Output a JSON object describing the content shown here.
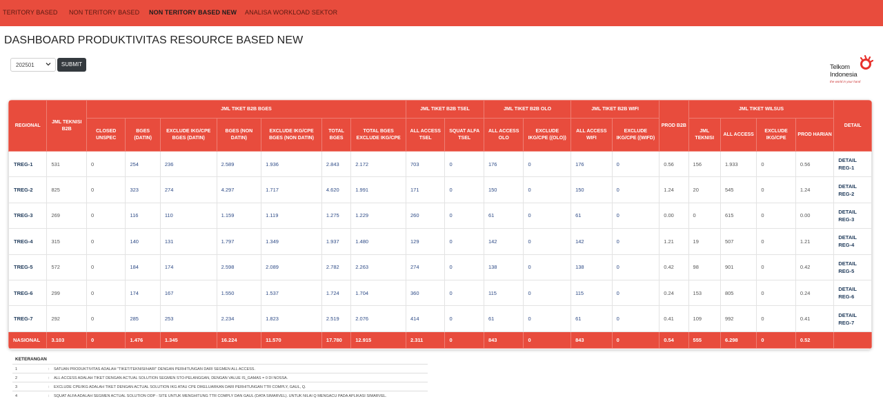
{
  "nav": {
    "items": [
      {
        "label": "TERITORY BASED",
        "active": false
      },
      {
        "label": "NON TERITORY BASED",
        "active": false
      },
      {
        "label": "NON TERITORY BASED NEW",
        "active": true
      },
      {
        "label": "ANALISA WORKLOAD SEKTOR",
        "active": false
      }
    ]
  },
  "page_title": "DASHBOARD PRODUKTIVITAS RESOURCE BASED NEW",
  "filter": {
    "period_value": "202501",
    "submit_label": "SUBMIT"
  },
  "logo": {
    "line1": "Telkom",
    "line2": "Indonesia",
    "tagline": "the world in your hand"
  },
  "table": {
    "group_headers": {
      "regional": "REGIONAL",
      "jml_teknisi_b2b": "JML TEKNISI B2B",
      "bges": "JML TIKET B2B BGES",
      "tsel": "JML TIKET B2B TSEL",
      "olo": "JML TIKET B2B OLO",
      "wifi": "JML TIKET B2B WIFI",
      "prod_b2b": "PROD B2B",
      "wilsus": "JML TIKET WILSUS",
      "detail": "DETAIL"
    },
    "sub_headers": [
      "CLOSED UNSPEC",
      "BGES (DATIN)",
      "EXCLUDE IKG/CPE BGES (DATIN)",
      "BGES (NON DATIN)",
      "EXCLUDE IKG/CPE BGES (NON DATIN)",
      "TOTAL BGES",
      "TOTAL BGES EXCLUDE IKG/CPE",
      "ALL ACCESS TSEL",
      "SQUAT ALFA TSEL",
      "ALL ACCESS OLO",
      "EXCLUDE IKG/CPE ((OLO))",
      "ALL ACCESS WIFI",
      "EXCLUDE IKG/CPE ((WIFD)",
      "JML TEKNISI",
      "ALL ACCESS",
      "EXCLUDE IKG/CPE",
      "PROD HARIAN"
    ],
    "rows": [
      {
        "region": "TREG-1",
        "cells": [
          "531",
          "0",
          "254",
          "236",
          "2.589",
          "1.936",
          "2.843",
          "2.172",
          "703",
          "0",
          "176",
          "0",
          "176",
          "0",
          "0.56",
          "156",
          "1.933",
          "0",
          "0.56"
        ],
        "detail": [
          "DETAIL",
          "REG-1"
        ]
      },
      {
        "region": "TREG-2",
        "cells": [
          "825",
          "0",
          "323",
          "274",
          "4.297",
          "1.717",
          "4.620",
          "1.991",
          "171",
          "0",
          "150",
          "0",
          "150",
          "0",
          "1.24",
          "20",
          "545",
          "0",
          "1.24"
        ],
        "detail": [
          "DETAIL",
          "REG-2"
        ]
      },
      {
        "region": "TREG-3",
        "cells": [
          "269",
          "0",
          "116",
          "110",
          "1.159",
          "1.119",
          "1.275",
          "1.229",
          "260",
          "0",
          "61",
          "0",
          "61",
          "0",
          "0.00",
          "0",
          "615",
          "0",
          "0.00"
        ],
        "detail": [
          "DETAIL",
          "REG-3"
        ]
      },
      {
        "region": "TREG-4",
        "cells": [
          "315",
          "0",
          "140",
          "131",
          "1.797",
          "1.349",
          "1.937",
          "1.480",
          "129",
          "0",
          "142",
          "0",
          "142",
          "0",
          "1.21",
          "19",
          "507",
          "0",
          "1.21"
        ],
        "detail": [
          "DETAIL",
          "REG-4"
        ]
      },
      {
        "region": "TREG-5",
        "cells": [
          "572",
          "0",
          "184",
          "174",
          "2.598",
          "2.089",
          "2.782",
          "2.263",
          "274",
          "0",
          "138",
          "0",
          "138",
          "0",
          "0.42",
          "98",
          "901",
          "0",
          "0.42"
        ],
        "detail": [
          "DETAIL",
          "REG-5"
        ]
      },
      {
        "region": "TREG-6",
        "cells": [
          "299",
          "0",
          "174",
          "167",
          "1.550",
          "1.537",
          "1.724",
          "1.704",
          "360",
          "0",
          "115",
          "0",
          "115",
          "0",
          "0.24",
          "153",
          "805",
          "0",
          "0.24"
        ],
        "detail": [
          "DETAIL",
          "REG-6"
        ]
      },
      {
        "region": "TREG-7",
        "cells": [
          "292",
          "0",
          "285",
          "253",
          "2.234",
          "1.823",
          "2.519",
          "2.076",
          "414",
          "0",
          "61",
          "0",
          "61",
          "0",
          "0.41",
          "109",
          "992",
          "0",
          "0.41"
        ],
        "detail": [
          "DETAIL",
          "REG-7"
        ]
      }
    ],
    "total": {
      "region": "NASIONAL",
      "cells": [
        "3.103",
        "0",
        "1.476",
        "1.345",
        "16.224",
        "11.570",
        "17.780",
        "12.915",
        "2.311",
        "0",
        "843",
        "0",
        "843",
        "0",
        "0.54",
        "555",
        "6.298",
        "0",
        "0.52"
      ],
      "detail": ""
    }
  },
  "notes": {
    "title": "KETERANGAN",
    "items": [
      {
        "no": "1",
        "text": "SATUAN PRODUKTIVITAS ADALAH \"TIKET/TEKNISI/HARI\" DENGAN PERHITUNGAN DARI SEGMEN ALL ACCESS."
      },
      {
        "no": "2",
        "text": "ALL ACCESS ADALAH TIKET DENGAN ACTUAL SOLUTION SEGMEN STO-PELANGGAN, DENGAN VALUE IS_GAMAS = 0 DI NOSSA."
      },
      {
        "no": "3",
        "text": "EXCLUDE CPE/IKG ADALAH TIKET DENGAN ACTUAL SOLUTION IKG ATAU CPE DIKELUARKAN DARI PERHITUNGAN TTR COMPLY, GAUL, Q."
      },
      {
        "no": "4",
        "text": "SQUAT ALFA ADALAH SEGMEN ACTUAL SOLUTION ODP - SITE UNTUK MENGHITUNG TTR COMPLY DAN GAUL (DATA SIMARVEL). UNTUK NILAI Q MENGACU PADA APLIKASI SIMARVEL."
      }
    ]
  }
}
